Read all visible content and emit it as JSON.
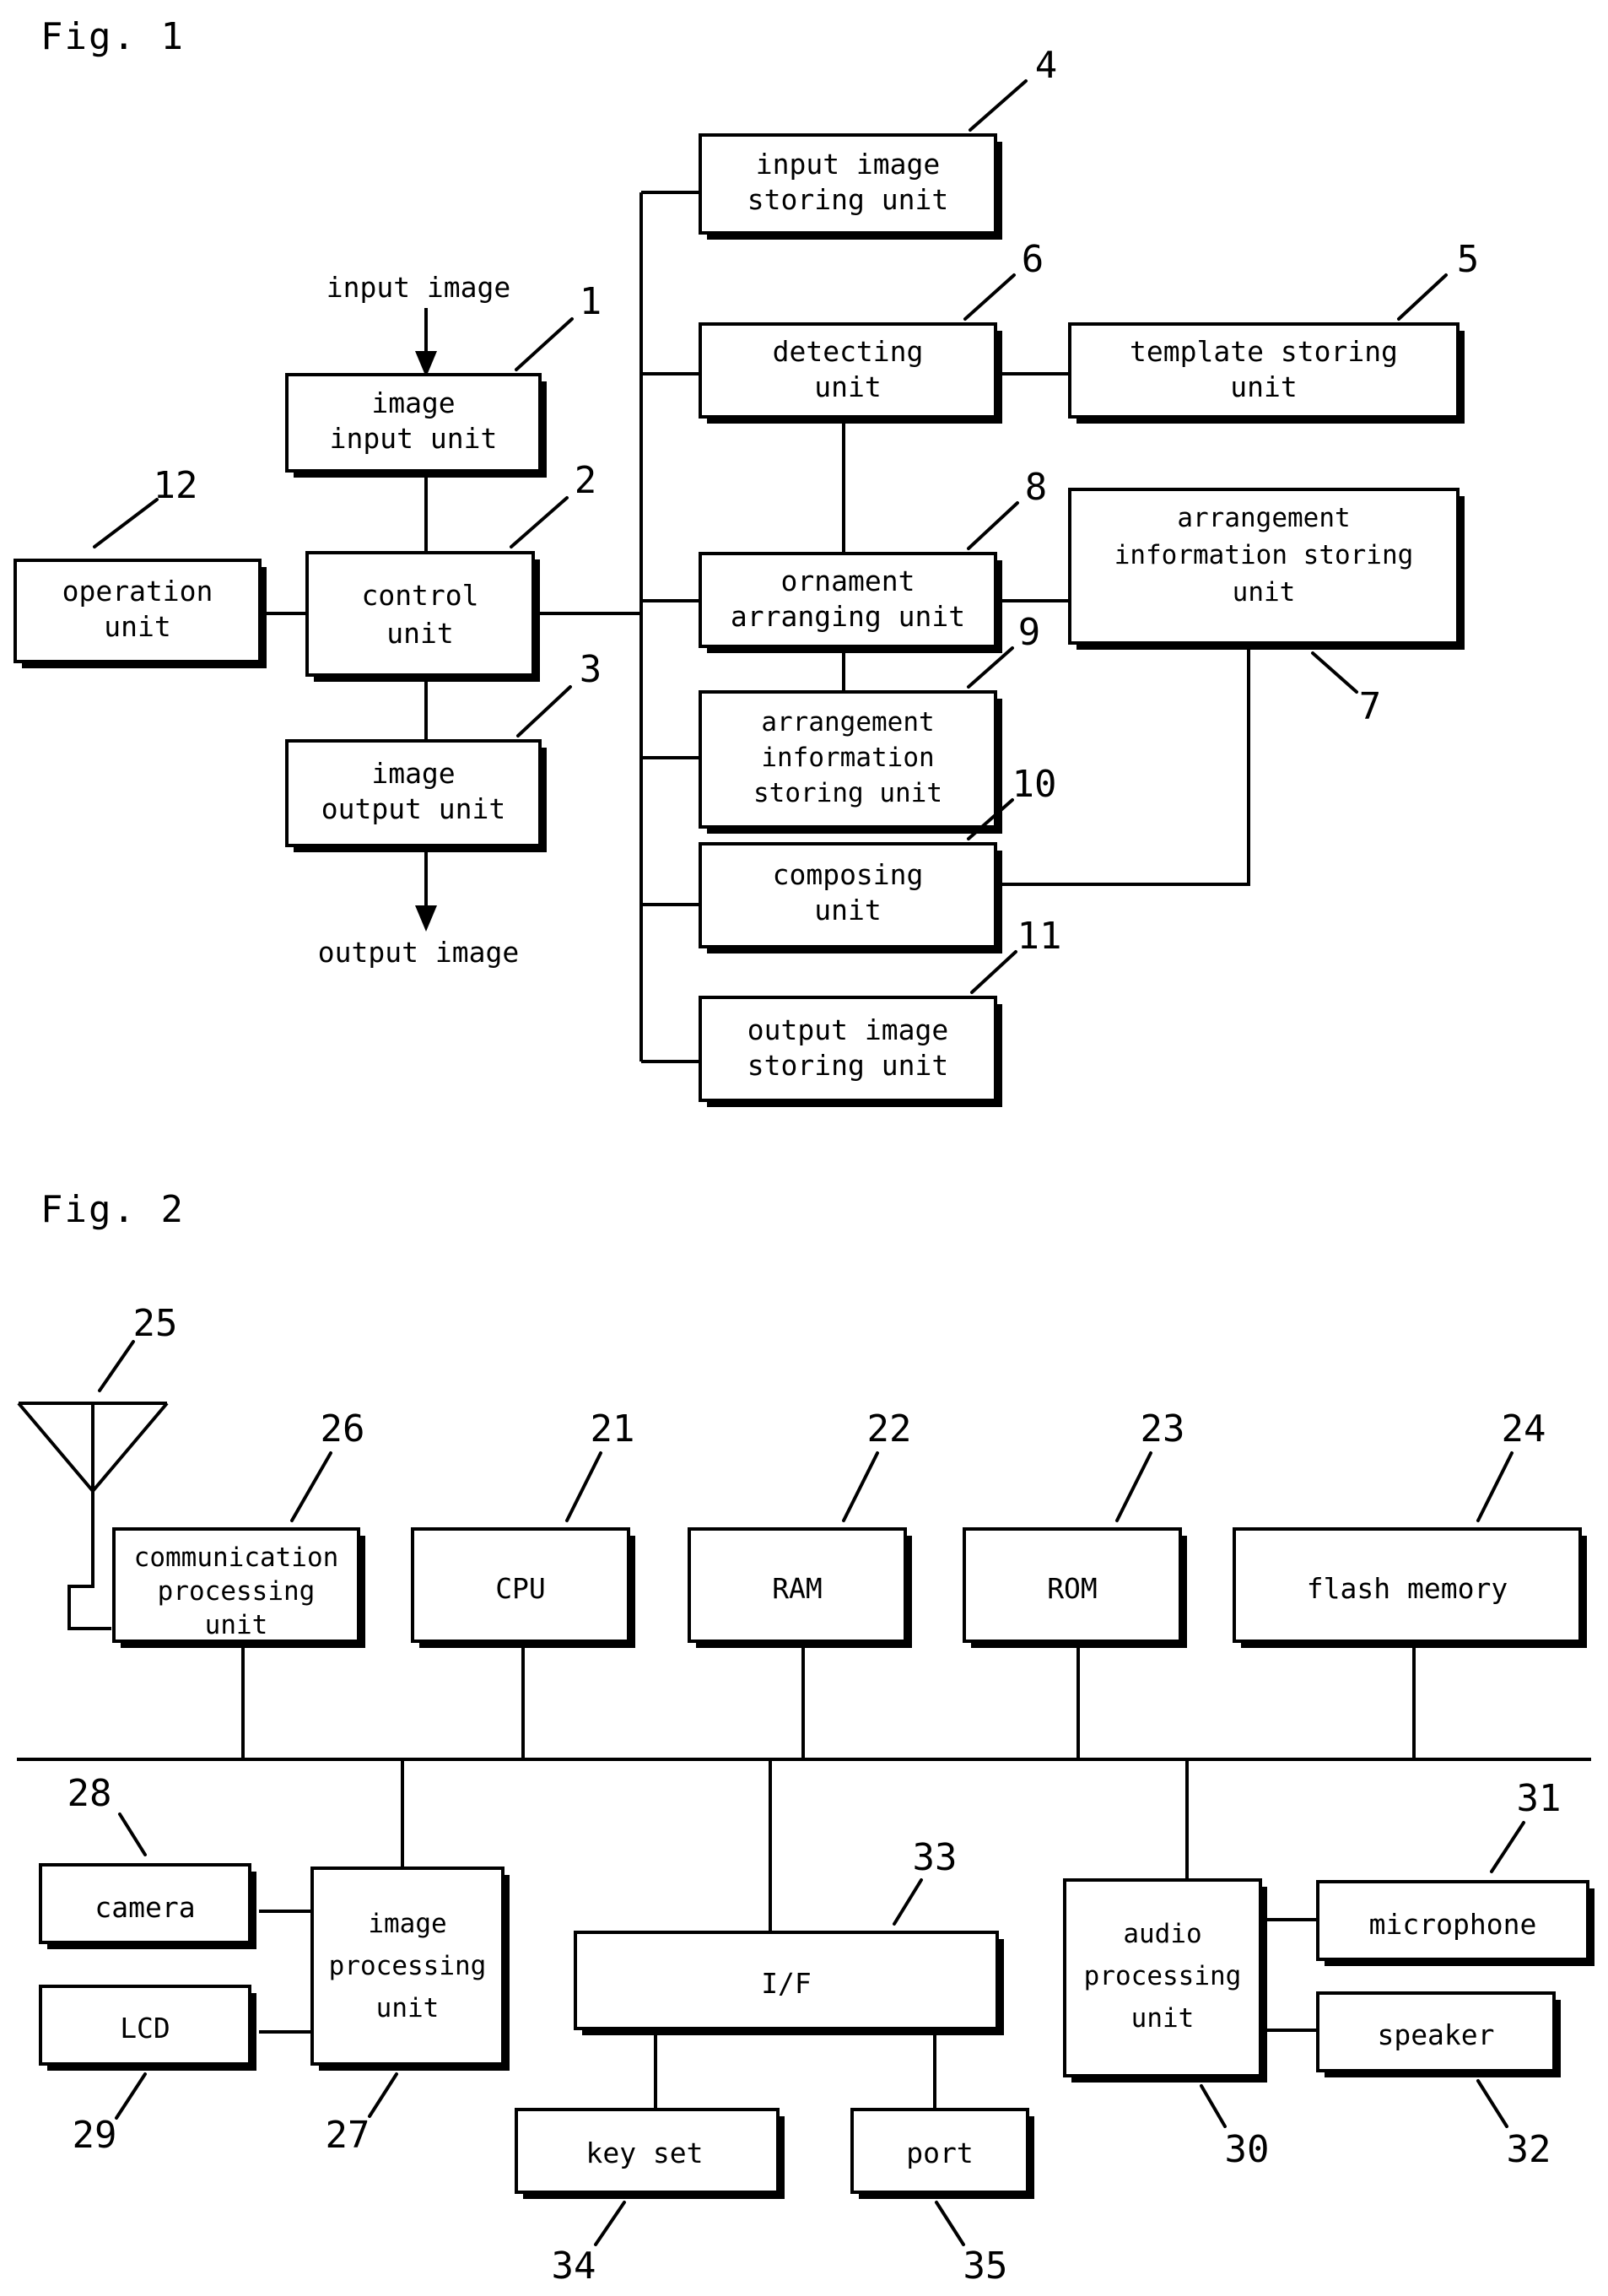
{
  "figures": [
    {
      "id": "fig1",
      "label": "Fig. 1",
      "free_texts": [
        {
          "name": "input-image-label",
          "text": "input image"
        },
        {
          "name": "output-image-label",
          "text": "output image"
        }
      ],
      "boxes": [
        {
          "name": "image-input-unit",
          "ref": "1",
          "lines": [
            "image",
            "input unit"
          ]
        },
        {
          "name": "control-unit",
          "ref": "2",
          "lines": [
            "control",
            "unit"
          ]
        },
        {
          "name": "image-output-unit",
          "ref": "3",
          "lines": [
            "image",
            "output unit"
          ]
        },
        {
          "name": "input-image-storing-unit",
          "ref": "4",
          "lines": [
            "input image",
            "storing unit"
          ]
        },
        {
          "name": "template-storing-unit",
          "ref": "5",
          "lines": [
            "template storing",
            "unit"
          ]
        },
        {
          "name": "detecting-unit",
          "ref": "6",
          "lines": [
            "detecting",
            "unit"
          ]
        },
        {
          "name": "arrangement-information-storing-unit-7",
          "ref": "7",
          "lines": [
            "arrangement",
            "information storing",
            "unit"
          ]
        },
        {
          "name": "ornament-arranging-unit",
          "ref": "8",
          "lines": [
            "ornament",
            "arranging unit"
          ]
        },
        {
          "name": "arrangement-information-storing-unit-9",
          "ref": "9",
          "lines": [
            "arrangement",
            "information",
            "storing unit"
          ]
        },
        {
          "name": "composing-unit",
          "ref": "10",
          "lines": [
            "composing",
            "unit"
          ]
        },
        {
          "name": "output-image-storing-unit",
          "ref": "11",
          "lines": [
            "output image",
            "storing unit"
          ]
        },
        {
          "name": "operation-unit",
          "ref": "12",
          "lines": [
            "operation",
            "unit"
          ]
        }
      ]
    },
    {
      "id": "fig2",
      "label": "Fig. 2",
      "boxes": [
        {
          "name": "cpu",
          "ref": "21",
          "lines": [
            "CPU"
          ]
        },
        {
          "name": "ram",
          "ref": "22",
          "lines": [
            "RAM"
          ]
        },
        {
          "name": "rom",
          "ref": "23",
          "lines": [
            "ROM"
          ]
        },
        {
          "name": "flash-memory",
          "ref": "24",
          "lines": [
            "flash memory"
          ]
        },
        {
          "name": "antenna",
          "ref": "25",
          "lines": []
        },
        {
          "name": "communication-processing-unit",
          "ref": "26",
          "lines": [
            "communication",
            "processing",
            "unit"
          ]
        },
        {
          "name": "image-processing-unit",
          "ref": "27",
          "lines": [
            "image",
            "processing",
            "unit"
          ]
        },
        {
          "name": "camera",
          "ref": "28",
          "lines": [
            "camera"
          ]
        },
        {
          "name": "lcd",
          "ref": "29",
          "lines": [
            "LCD"
          ]
        },
        {
          "name": "audio-processing-unit",
          "ref": "30",
          "lines": [
            "audio",
            "processing",
            "unit"
          ]
        },
        {
          "name": "microphone",
          "ref": "31",
          "lines": [
            "microphone"
          ]
        },
        {
          "name": "speaker",
          "ref": "32",
          "lines": [
            "speaker"
          ]
        },
        {
          "name": "interface",
          "ref": "33",
          "lines": [
            "I/F"
          ]
        },
        {
          "name": "key-set",
          "ref": "34",
          "lines": [
            "key set"
          ]
        },
        {
          "name": "port",
          "ref": "35",
          "lines": [
            "port"
          ]
        }
      ]
    }
  ],
  "colors": {
    "ink": "#000000",
    "paper": "#ffffff"
  },
  "fig1": {
    "label": "Fig. 1",
    "input_image": "input image",
    "output_image": "output image",
    "b1_l1": "image",
    "b1_l2": "input unit",
    "b1_ref": "1",
    "b2_l1": "control",
    "b2_l2": "unit",
    "b2_ref": "2",
    "b3_l1": "image",
    "b3_l2": "output unit",
    "b3_ref": "3",
    "b4_l1": "input image",
    "b4_l2": "storing unit",
    "b4_ref": "4",
    "b5_l1": "template storing",
    "b5_l2": "unit",
    "b5_ref": "5",
    "b6_l1": "detecting",
    "b6_l2": "unit",
    "b6_ref": "6",
    "b7_l1": "arrangement",
    "b7_l2": "information storing",
    "b7_l3": "unit",
    "b7_ref": "7",
    "b8_l1": "ornament",
    "b8_l2": "arranging unit",
    "b8_ref": "8",
    "b9_l1": "arrangement",
    "b9_l2": "information",
    "b9_l3": "storing unit",
    "b9_ref": "9",
    "b10_l1": "composing",
    "b10_l2": "unit",
    "b10_ref": "10",
    "b11_l1": "output image",
    "b11_l2": "storing unit",
    "b11_ref": "11",
    "b12_l1": "operation",
    "b12_l2": "unit",
    "b12_ref": "12"
  },
  "fig2": {
    "label": "Fig. 2",
    "antenna_ref": "25",
    "b26_l1": "communication",
    "b26_l2": "processing",
    "b26_l3": "unit",
    "b26_ref": "26",
    "b21_l1": "CPU",
    "b21_ref": "21",
    "b22_l1": "RAM",
    "b22_ref": "22",
    "b23_l1": "ROM",
    "b23_ref": "23",
    "b24_l1": "flash memory",
    "b24_ref": "24",
    "b28_l1": "camera",
    "b28_ref": "28",
    "b29_l1": "LCD",
    "b29_ref": "29",
    "b27_l1": "image",
    "b27_l2": "processing",
    "b27_l3": "unit",
    "b27_ref": "27",
    "b33_l1": "I/F",
    "b33_ref": "33",
    "b34_l1": "key set",
    "b34_ref": "34",
    "b35_l1": "port",
    "b35_ref": "35",
    "b30_l1": "audio",
    "b30_l2": "processing",
    "b30_l3": "unit",
    "b30_ref": "30",
    "b31_l1": "microphone",
    "b31_ref": "31",
    "b32_l1": "speaker",
    "b32_ref": "32"
  }
}
